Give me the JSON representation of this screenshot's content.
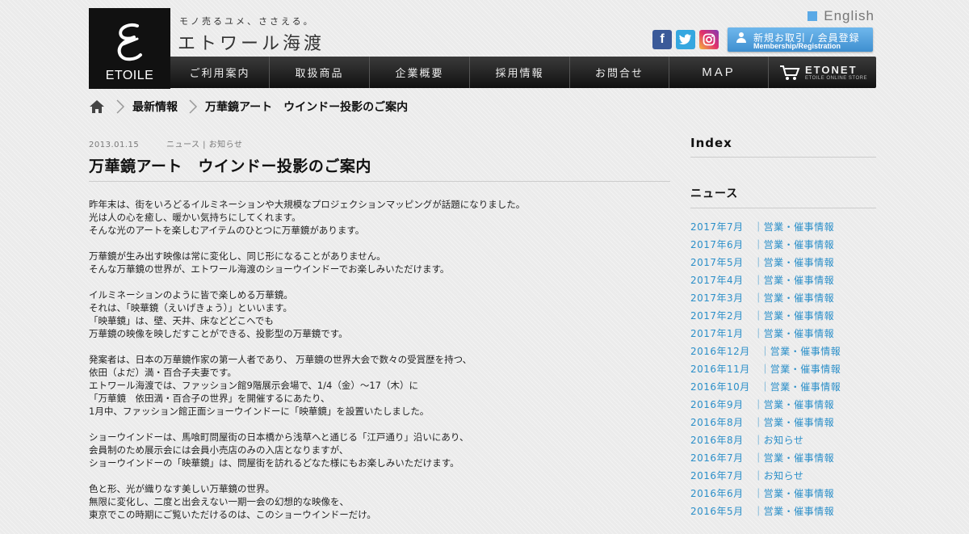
{
  "header": {
    "logo_text": "ETOILE",
    "tagline": "モノ売るユメ、ささえる。",
    "company": "エトワール海渡",
    "english_label": "English",
    "register_jp": "新規お取引 / 会員登録",
    "register_en": "Membership/Registration",
    "social": {
      "facebook": "f",
      "twitter": "t",
      "instagram": "◎"
    }
  },
  "nav": {
    "items": [
      "ご利用案内",
      "取扱商品",
      "企業概要",
      "採用情報",
      "お問合せ",
      "MAP"
    ],
    "etonet": "ETONET",
    "etonet_sub": "ETOILE ONLINE STORE"
  },
  "breadcrumb": {
    "items": [
      "最新情報",
      "万華鏡アート　ウインドー投影のご案内"
    ]
  },
  "article": {
    "date": "2013.01.15",
    "category": "ニュース | お知らせ",
    "title": "万華鏡アート　ウインドー投影のご案内",
    "paragraphs": [
      [
        "昨年末は、街をいろどるイルミネーションや大規模なプロジェクションマッピングが話題になりました。",
        "光は人の心を癒し、暖かい気持ちにしてくれます。",
        "そんな光のアートを楽しむアイテムのひとつに万華鏡があります。"
      ],
      [
        "万華鏡が生み出す映像は常に変化し、同じ形になることがありません。",
        "そんな万華鏡の世界が、エトワール海渡のショーウインドーでお楽しみいただけます。"
      ],
      [
        "イルミネーションのように皆で楽しめる万華鏡。",
        "それは、「映華鏡（えいげきょう）」といいます。",
        "「映華鏡」は、壁、天井、床などどこへでも",
        "万華鏡の映像を映しだすことができる、投影型の万華鏡です。"
      ],
      [
        "発案者は、日本の万華鏡作家の第一人者であり、 万華鏡の世界大会で数々の受賞歴を持つ、",
        "依田（よだ）満・百合子夫妻です。",
        "エトワール海渡では、ファッション館9階展示会場で、1/4（金）～17（木）に",
        "「万華鏡　依田満・百合子の世界」を開催するにあたり、",
        "1月中、ファッション館正面ショーウインドーに「映華鏡」を設置いたしました。"
      ],
      [
        "ショーウインドーは、馬喰町問屋街の日本橋から浅草へと通じる「江戸通り」沿いにあり、",
        "会員制のため展示会には会員小売店のみの入店となりますが、",
        "ショーウインドーの「映華鏡」は、問屋街を訪れるどなた様にもお楽しみいただけます。"
      ],
      [
        "色と形、光が織りなす美しい万華鏡の世界。",
        "無限に変化し、二度と出会えない一期一会の幻想的な映像を、",
        "東京でこの時期にご覧いただけるのは、このショーウインドーだけ。"
      ]
    ]
  },
  "sidebar": {
    "index_title": "Index",
    "news_title": "ニュース",
    "items": [
      "2017年7月　｜営業・催事情報",
      "2017年6月　｜営業・催事情報",
      "2017年5月　｜営業・催事情報",
      "2017年4月　｜営業・催事情報",
      "2017年3月　｜営業・催事情報",
      "2017年2月　｜営業・催事情報",
      "2017年1月　｜営業・催事情報",
      "2016年12月　｜営業・催事情報",
      "2016年11月　｜営業・催事情報",
      "2016年10月　｜営業・催事情報",
      "2016年9月　｜営業・催事情報",
      "2016年8月　｜営業・催事情報",
      "2016年8月　｜お知らせ",
      "2016年7月　｜営業・催事情報",
      "2016年7月　｜お知らせ",
      "2016年6月　｜営業・催事情報",
      "2016年5月　｜営業・催事情報"
    ]
  }
}
